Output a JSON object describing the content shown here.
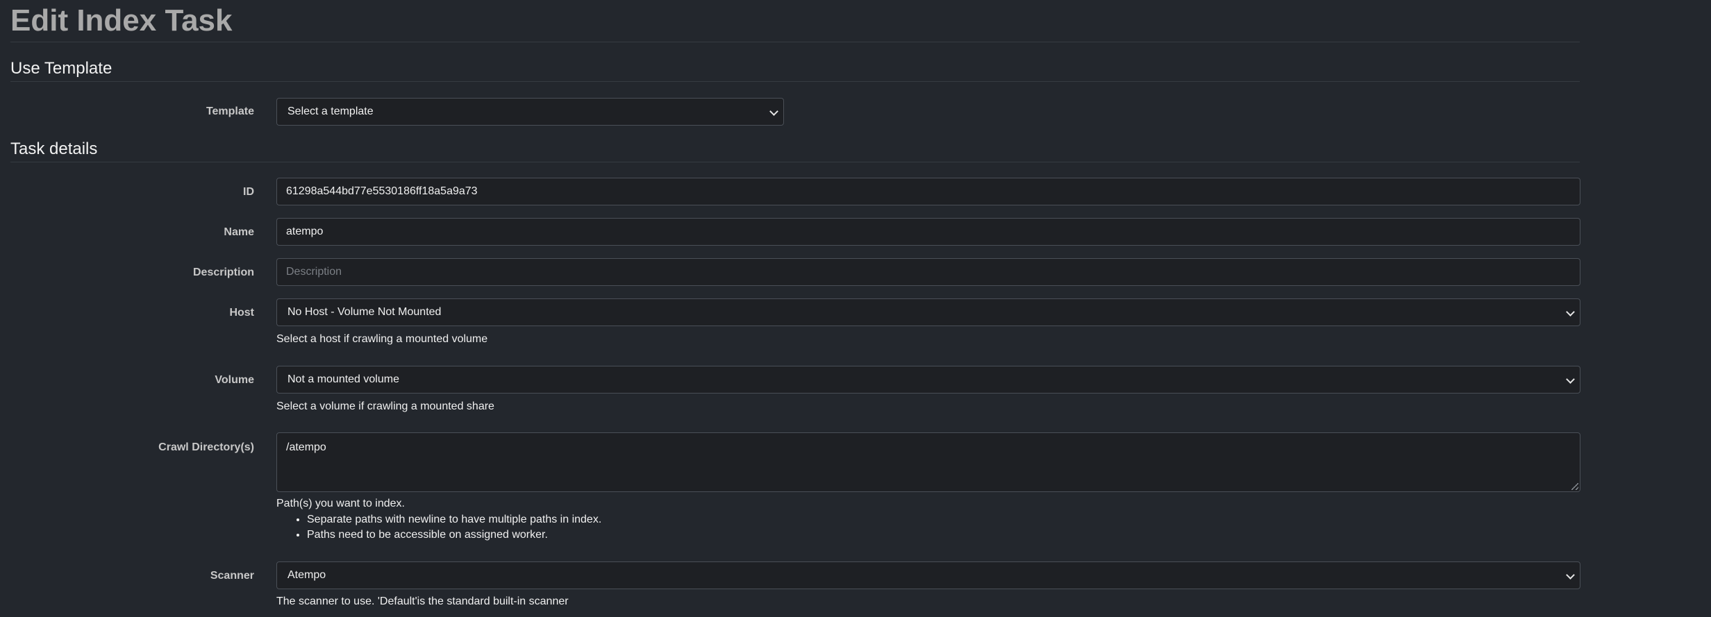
{
  "page": {
    "title": "Edit Index Task"
  },
  "template_section": {
    "title": "Use Template",
    "template_label": "Template",
    "template_value": "Select a template"
  },
  "details_section": {
    "title": "Task details",
    "id": {
      "label": "ID",
      "value": "61298a544bd77e5530186ff18a5a9a73"
    },
    "name": {
      "label": "Name",
      "value": "atempo"
    },
    "description": {
      "label": "Description",
      "placeholder": "Description",
      "value": ""
    },
    "host": {
      "label": "Host",
      "value": "No Host - Volume Not Mounted",
      "help": "Select a host if crawling a mounted volume"
    },
    "volume": {
      "label": "Volume",
      "value": "Not a mounted volume",
      "help": "Select a volume if crawling a mounted share"
    },
    "crawl_dirs": {
      "label": "Crawl Directory(s)",
      "value": "/atempo",
      "help": "Path(s) you want to index.",
      "help_bullets": [
        "Separate paths with newline to have multiple paths in index.",
        "Paths need to be accessible on assigned worker."
      ]
    },
    "scanner": {
      "label": "Scanner",
      "value": "Atempo",
      "help": "The scanner to use. 'Default'is the standard built-in scanner"
    }
  },
  "icons": {
    "select_chevron": "chevron-down-icon",
    "textarea_grip": "resize-grip-icon"
  },
  "colors": {
    "background": "#23272d",
    "field_background": "#1e2024",
    "field_border": "#4a4f57",
    "title": "#a9a9a9"
  }
}
